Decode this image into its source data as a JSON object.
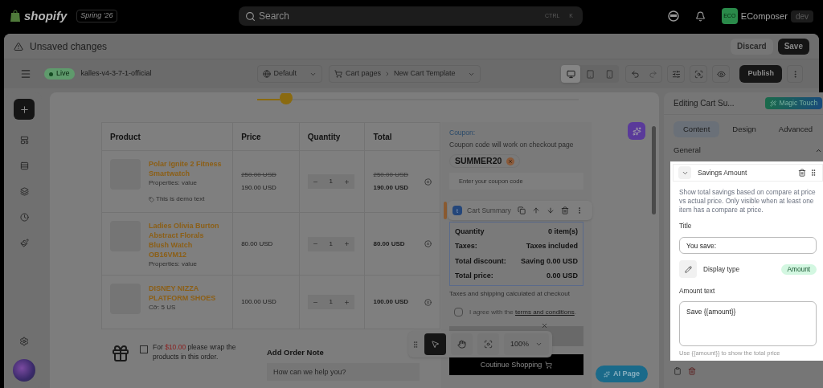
{
  "topbar": {
    "brand": "shopify",
    "edition": "Spring '26",
    "search": {
      "placeholder": "Search",
      "keys": [
        "CTRL",
        "K"
      ]
    },
    "account": {
      "initials": "ECO",
      "name": "EComposer",
      "badge": "dev"
    }
  },
  "unsaved_bar": {
    "message": "Unsaved changes",
    "buttons": [
      {
        "label": "Discard",
        "kind": "secondary"
      },
      {
        "label": "Save",
        "kind": "primary"
      }
    ]
  },
  "toolbar": {
    "status": "Live",
    "store": "kalles-v4-3-7-1-official",
    "locale": "Default",
    "breadcrumb": [
      "Cart pages",
      "New Cart Template"
    ],
    "devices": [
      {
        "kind": "desktop",
        "selected": true
      },
      {
        "kind": "tablet",
        "selected": false
      },
      {
        "kind": "mobile",
        "selected": false
      }
    ],
    "publish": "Publish"
  },
  "sidebar": {
    "items": [
      {
        "kind": "add",
        "selected": true
      },
      {
        "kind": "sections",
        "selected": false
      },
      {
        "kind": "rows",
        "selected": false
      },
      {
        "kind": "layers",
        "selected": false
      },
      {
        "kind": "history",
        "selected": false
      },
      {
        "kind": "style",
        "selected": false
      }
    ]
  },
  "cart": {
    "columns": [
      "Product",
      "Price",
      "Quantity",
      "Total"
    ],
    "items": [
      {
        "name": "Polar Ignite 2 Fitness Smartwatch",
        "properties": "Properties: value",
        "note": "This is demo text",
        "compare_price": "250.00 USD",
        "price": "190.00 USD",
        "quantity": "1",
        "compare_total": "250.00 USD",
        "total": "190.00 USD"
      },
      {
        "name": "Ladies Olivia Burton Abstract Florals Blush Watch OB16VM12",
        "properties": "Properties: value",
        "price": "80.00 USD",
        "quantity": "1",
        "total": "80.00 USD"
      },
      {
        "name": "DISNEY NIZZA PLATFORM SHOES",
        "properties": "Cỡ: 5 US",
        "price": "100.00 USD",
        "quantity": "1",
        "total": "100.00 USD"
      }
    ],
    "gift": {
      "checked": false,
      "prefix": "For",
      "amount": "$10.00",
      "suffix": "please wrap the products in this order."
    },
    "order_note": {
      "title": "Add Order Note",
      "placeholder": "How can we help you?"
    }
  },
  "summary": {
    "coupon_label": "Coupon:",
    "coupon_hint": "Coupon code will work on checkout page",
    "applied_code": "SUMMER20",
    "coupon_placeholder": "Enter your coupon code",
    "rows": [
      {
        "label": "Quantity",
        "value": "0 item(s)"
      },
      {
        "label": "Taxes:",
        "value": "Taxes included"
      },
      {
        "label": "Total discount:",
        "value": "Saving 0.00 USD"
      },
      {
        "label": "Total price:",
        "value": "0.00 USD"
      }
    ],
    "note": "Taxes and shipping calculated at checkout",
    "agree": {
      "checked": false,
      "prefix": "I agree with the",
      "link": "terms and conditions",
      "suffix": "."
    },
    "continue": "Coutinue Shopping"
  },
  "element_toolbar": {
    "letter": "t",
    "label": "Cart Summary"
  },
  "canvas_tools": {
    "tools": [
      {
        "kind": "pointer",
        "selected": true
      },
      {
        "kind": "hand",
        "selected": false
      },
      {
        "kind": "focus",
        "selected": false
      }
    ],
    "zoom": "100%"
  },
  "ai_button": "AI Page",
  "panel": {
    "title": "Editing Cart Su...",
    "magic": "Magic Touch",
    "tabs": [
      {
        "label": "Content",
        "selected": true
      },
      {
        "label": "Design",
        "selected": false
      },
      {
        "label": "Advanced",
        "selected": false
      }
    ],
    "section": {
      "title": "General",
      "expanded": true
    },
    "block": {
      "title": "Savings Amount",
      "expanded": true,
      "description": "Show total savings based on compare at price vs actual price. Only visible when at least one item has a compare at price.",
      "fields": [
        {
          "kind": "input",
          "label": "Title",
          "value": "You save:"
        },
        {
          "kind": "choice",
          "label": "Display type",
          "value": "Amount"
        },
        {
          "kind": "textarea",
          "label": "Amount text",
          "value": "Save {{amount}}"
        }
      ],
      "hint": "Use {{amount}} to show the total price"
    }
  }
}
